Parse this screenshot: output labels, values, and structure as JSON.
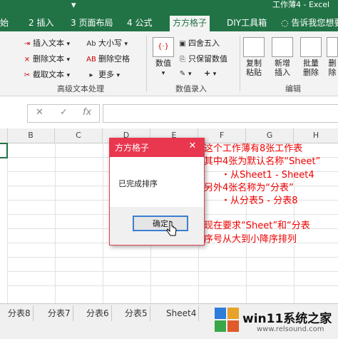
{
  "window": {
    "title": "工作薄4 - Excel"
  },
  "ribbon_tabs": [
    {
      "label": "始"
    },
    {
      "label": "2 插入"
    },
    {
      "label": "3 页面布局"
    },
    {
      "label": "4 公式"
    },
    {
      "label": "方方格子"
    },
    {
      "label": "DIY工具箱"
    },
    {
      "label": "告诉我您想要"
    }
  ],
  "ribbon": {
    "text_group": {
      "items": [
        "插入文本",
        "删除文本",
        "截取文本",
        "大小写",
        "删除空格",
        "更多"
      ],
      "label": "高级文本处理"
    },
    "number_group": {
      "big": "数值",
      "items": [
        "四舍五入",
        "只保留数值"
      ],
      "label": "数值录入"
    },
    "edit_group": {
      "buttons": [
        "复制粘贴",
        "新增插入",
        "批量删除",
        "删除"
      ],
      "label": "编辑"
    }
  },
  "formula_bar": {
    "cancel": "✕",
    "enter": "✓",
    "fx": "fx"
  },
  "columns": [
    "B",
    "C",
    "D",
    "E",
    "F",
    "G",
    "H"
  ],
  "sheet_notes": [
    "这个工作薄有8张工作表",
    "其中4张为默认名称“Sheet”",
    "・从Sheet1 - Sheet4",
    "另外4张名称为“分表”",
    "・从分表5 - 分表8",
    "现在要求“Sheet”和“分表",
    "序号从大到小降序排列"
  ],
  "dialog": {
    "title": "方方格子",
    "message": "已完成排序",
    "ok_label": "确定",
    "close": "✕"
  },
  "sheet_tabs": [
    "分表8",
    "分表7",
    "分表6",
    "分表5",
    "Sheet4"
  ],
  "watermark": {
    "brand": "win11系统之家",
    "url": "www.relsound.com"
  },
  "colors": {
    "excel_green": "#217346",
    "dialog_red": "#e8374f",
    "note_red": "#e00000"
  }
}
